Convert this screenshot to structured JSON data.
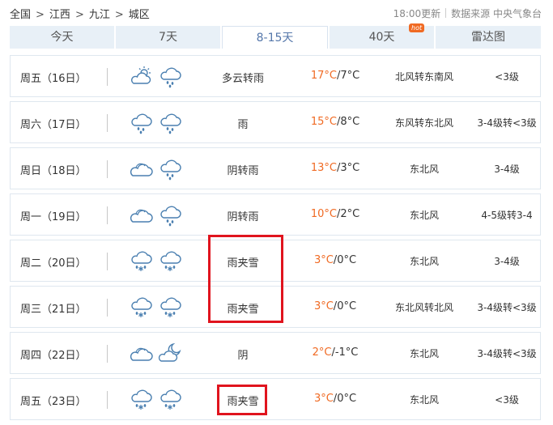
{
  "breadcrumb": [
    "全国",
    "江西",
    "九江",
    "城区"
  ],
  "meta": {
    "updated": "18:00更新",
    "source": "数据来源 中央气象台"
  },
  "tabs": [
    {
      "label": "今天",
      "active": false
    },
    {
      "label": "7天",
      "active": false
    },
    {
      "label": "8-15天",
      "active": true
    },
    {
      "label": "40天",
      "active": false,
      "badge": "hot"
    },
    {
      "label": "雷达图",
      "active": false
    }
  ],
  "days": [
    {
      "date": "周五（16日）",
      "icons": [
        "partly-cloudy-sun-icon",
        "rain-cloud-icon"
      ],
      "desc": "多云转雨",
      "temp_high": "17°C",
      "temp_low": "7°C",
      "wind": "北风转东南风",
      "level": "<3级",
      "highlighted": false
    },
    {
      "date": "周六（17日）",
      "icons": [
        "rain-cloud-icon",
        "rain-cloud-icon"
      ],
      "desc": "雨",
      "temp_high": "15°C",
      "temp_low": "8°C",
      "wind": "东风转东北风",
      "level": "3-4级转<3级",
      "highlighted": false
    },
    {
      "date": "周日（18日）",
      "icons": [
        "overcast-cloud-icon",
        "rain-cloud-icon"
      ],
      "desc": "阴转雨",
      "temp_high": "13°C",
      "temp_low": "3°C",
      "wind": "东北风",
      "level": "3-4级",
      "highlighted": false
    },
    {
      "date": "周一（19日）",
      "icons": [
        "overcast-cloud-icon",
        "rain-cloud-icon"
      ],
      "desc": "阴转雨",
      "temp_high": "10°C",
      "temp_low": "2°C",
      "wind": "东北风",
      "level": "4-5级转3-4",
      "highlighted": false
    },
    {
      "date": "周二（20日）",
      "icons": [
        "sleet-cloud-icon",
        "sleet-cloud-icon"
      ],
      "desc": "雨夹雪",
      "temp_high": "3°C",
      "temp_low": "0°C",
      "wind": "东北风",
      "level": "3-4级",
      "highlighted": true
    },
    {
      "date": "周三（21日）",
      "icons": [
        "sleet-cloud-icon",
        "sleet-cloud-icon"
      ],
      "desc": "雨夹雪",
      "temp_high": "3°C",
      "temp_low": "0°C",
      "wind": "东北风转北风",
      "level": "3-4级转<3级",
      "highlighted": true
    },
    {
      "date": "周四（22日）",
      "icons": [
        "overcast-cloud-icon",
        "cloudy-night-moon-icon"
      ],
      "desc": "阴",
      "temp_high": "2°C",
      "temp_low": "-1°C",
      "wind": "东北风",
      "level": "3-4级转<3级",
      "highlighted": false
    },
    {
      "date": "周五（23日）",
      "icons": [
        "sleet-cloud-icon",
        "sleet-cloud-icon"
      ],
      "desc": "雨夹雪",
      "temp_high": "3°C",
      "temp_low": "0°C",
      "wind": "东北风",
      "level": "<3级",
      "highlighted": true
    }
  ],
  "colors": {
    "accent": "#5577aa",
    "temp_high": "#f06a23",
    "highlight": "#e0141e",
    "icon_stroke": "#4a7fb0"
  }
}
